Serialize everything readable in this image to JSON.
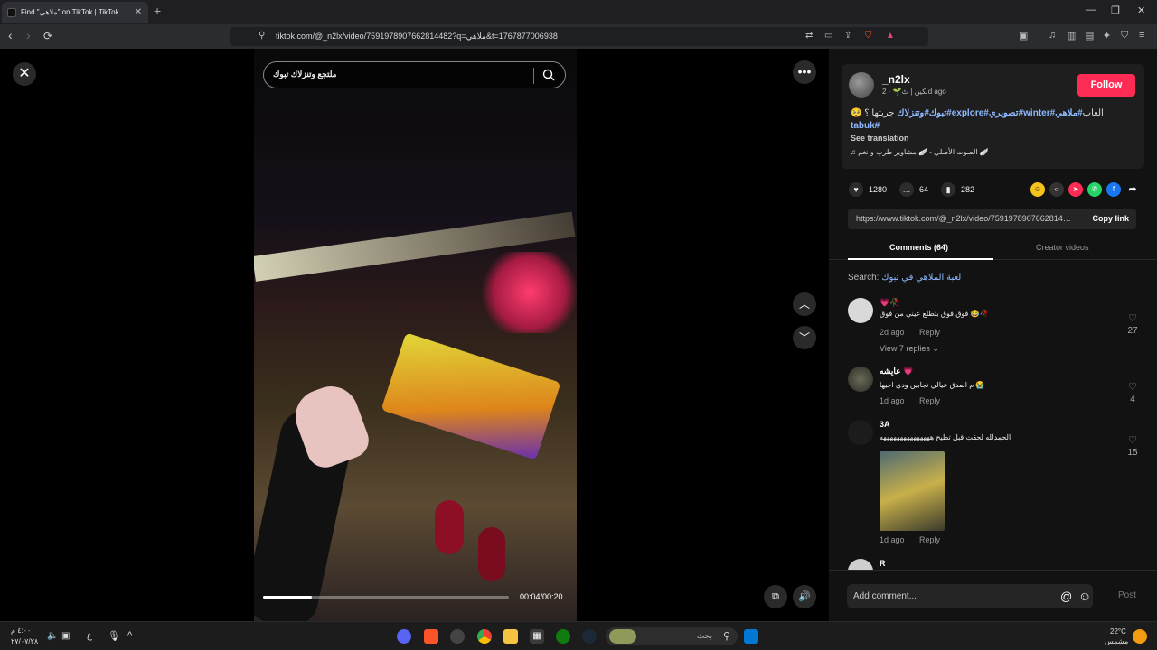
{
  "browser": {
    "tab_title": "Find \"ملاهي\" on TikTok | TikTok",
    "tab_close": "✕",
    "new_tab": "+",
    "url": "tiktok.com/@_n2lx/video/7591978907662814482?q=ملاهي&t=1767877006938"
  },
  "video": {
    "search_text": "ملتجع وتنزلاك تبوك",
    "time": "00:04/00:20",
    "progress": 0.2
  },
  "author": {
    "username": "_n2lx",
    "subline": "نكين | ٹ🌱 · 2d ago",
    "follow": "Follow"
  },
  "caption": {
    "text": "العاب",
    "tags_line1": [
      "#ملاهي",
      "#winter",
      "#تصويري",
      "#explore",
      "#تبوك",
      "#وتنزلاك"
    ],
    "lead": "جربتها ؟ 🥺",
    "tag_line2": "#tabuk",
    "see_translation": "See translation",
    "music": "♫ الصوت الأصلي - 🪽 مشاوير طرب و نغم 🪽"
  },
  "actions": {
    "likes": "1280",
    "comments": "64",
    "saves": "282"
  },
  "share_link": {
    "url": "https://www.tiktok.com/@_n2lx/video/7591978907662814482",
    "copy": "Copy link"
  },
  "panel_tabs": {
    "comments": "Comments (64)",
    "creator": "Creator videos"
  },
  "search": {
    "label": "Search:",
    "query": "لعبة الملاهي في تبوك"
  },
  "comments": [
    {
      "name": "💗🥀",
      "text": "فوق فوق بتطلع عيني من فوق 😂🥀",
      "time": "2d ago",
      "reply": "Reply",
      "likes": "27",
      "replies": "View 7 replies"
    },
    {
      "name": "عايشه 💗",
      "text": "م اصدق عيالي تجابين ودي اجيها 😭",
      "time": "1d ago",
      "reply": "Reply",
      "likes": "4"
    },
    {
      "name": "3A",
      "text": "الحمدلله لحقت قبل تطيح هههههههههههههههه",
      "time": "1d ago",
      "reply": "Reply",
      "likes": "15"
    },
    {
      "name": "R",
      "text": ""
    }
  ],
  "comment_box": {
    "placeholder": "Add comment...",
    "post": "Post"
  },
  "taskbar": {
    "time": "٤:٠٠ م",
    "date": "٢٧/٠٧/٢٨",
    "lang": "ع",
    "search_placeholder": "بحث",
    "weather_temp": "22°C",
    "weather_desc": "مشمس"
  }
}
